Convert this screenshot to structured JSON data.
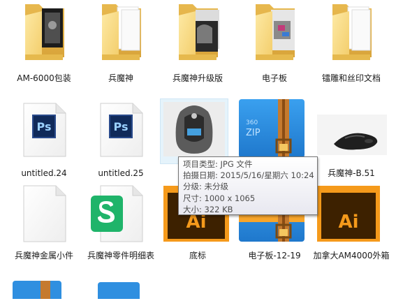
{
  "files": [
    {
      "label": "AM-6000包装",
      "icon": "folder-icon"
    },
    {
      "label": "兵魔神",
      "icon": "folder-icon"
    },
    {
      "label": "兵魔神升级版",
      "icon": "folder-icon"
    },
    {
      "label": "电子板",
      "icon": "folder-icon"
    },
    {
      "label": "镭雕和丝印文档",
      "icon": "folder-icon"
    },
    {
      "label": "untitled.24",
      "icon": "photoshop-file-icon",
      "badge": "Ps"
    },
    {
      "label": "untitled.25",
      "icon": "photoshop-file-icon",
      "badge": "Ps"
    },
    {
      "label": "",
      "icon": "jpg-mouse-image"
    },
    {
      "label": "",
      "icon": "360zip-archive-icon",
      "badge": "360 ZIP"
    },
    {
      "label": "兵魔神-B.51",
      "icon": "mouse-image"
    },
    {
      "label": "兵魔神金属小件",
      "icon": "blank-file-icon"
    },
    {
      "label": "兵魔神零件明细表",
      "icon": "wps-sheet-icon"
    },
    {
      "label": "底标",
      "icon": "illustrator-file-icon",
      "badge": "Ai"
    },
    {
      "label": "电子板-12-19",
      "icon": "360zip-archive-icon"
    },
    {
      "label": "加拿大AM4000外箱",
      "icon": "illustrator-file-icon",
      "badge": "Ai"
    }
  ],
  "tooltip": {
    "type": "项目类型: JPG 文件",
    "date": "拍摄日期: 2015/5/16/星期六 10:24",
    "rating": "分级: 未分级",
    "dimensions": "尺寸: 1000 x 1065",
    "size": "大小: 322 KB"
  },
  "colors": {
    "folder": "#f3d27a",
    "ps_blue": "#2a4b8c",
    "ai_orange": "#f59a1b",
    "ai_bg": "#3d2100",
    "zip_blue": "#2f8fe0",
    "zip_strap": "#c57a2e",
    "wps_green": "#1fb46a",
    "hover": "#e5f3fb"
  }
}
